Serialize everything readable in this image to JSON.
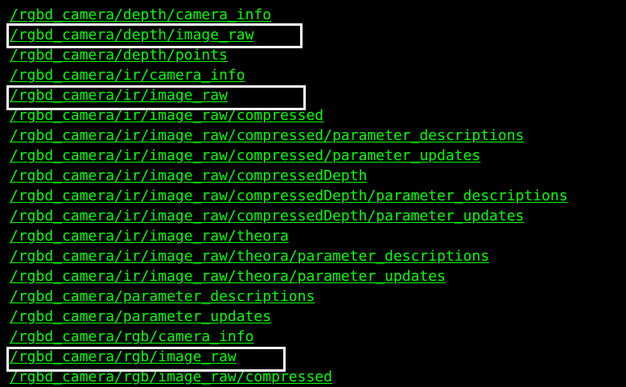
{
  "terminal": {
    "topics": [
      "/rgbd_camera/depth/camera_info",
      "/rgbd_camera/depth/image_raw",
      "/rgbd_camera/depth/points",
      "/rgbd_camera/ir/camera_info",
      "/rgbd_camera/ir/image_raw",
      "/rgbd_camera/ir/image_raw/compressed",
      "/rgbd_camera/ir/image_raw/compressed/parameter_descriptions",
      "/rgbd_camera/ir/image_raw/compressed/parameter_updates",
      "/rgbd_camera/ir/image_raw/compressedDepth",
      "/rgbd_camera/ir/image_raw/compressedDepth/parameter_descriptions",
      "/rgbd_camera/ir/image_raw/compressedDepth/parameter_updates",
      "/rgbd_camera/ir/image_raw/theora",
      "/rgbd_camera/ir/image_raw/theora/parameter_descriptions",
      "/rgbd_camera/ir/image_raw/theora/parameter_updates",
      "/rgbd_camera/parameter_descriptions",
      "/rgbd_camera/parameter_updates",
      "/rgbd_camera/rgb/camera_info",
      "/rgbd_camera/rgb/image_raw",
      "/rgbd_camera/rgb/image_raw/compressed"
    ],
    "text_color": "#00ff00",
    "background_color": "#000000",
    "highlight_color": "#ffffff"
  }
}
